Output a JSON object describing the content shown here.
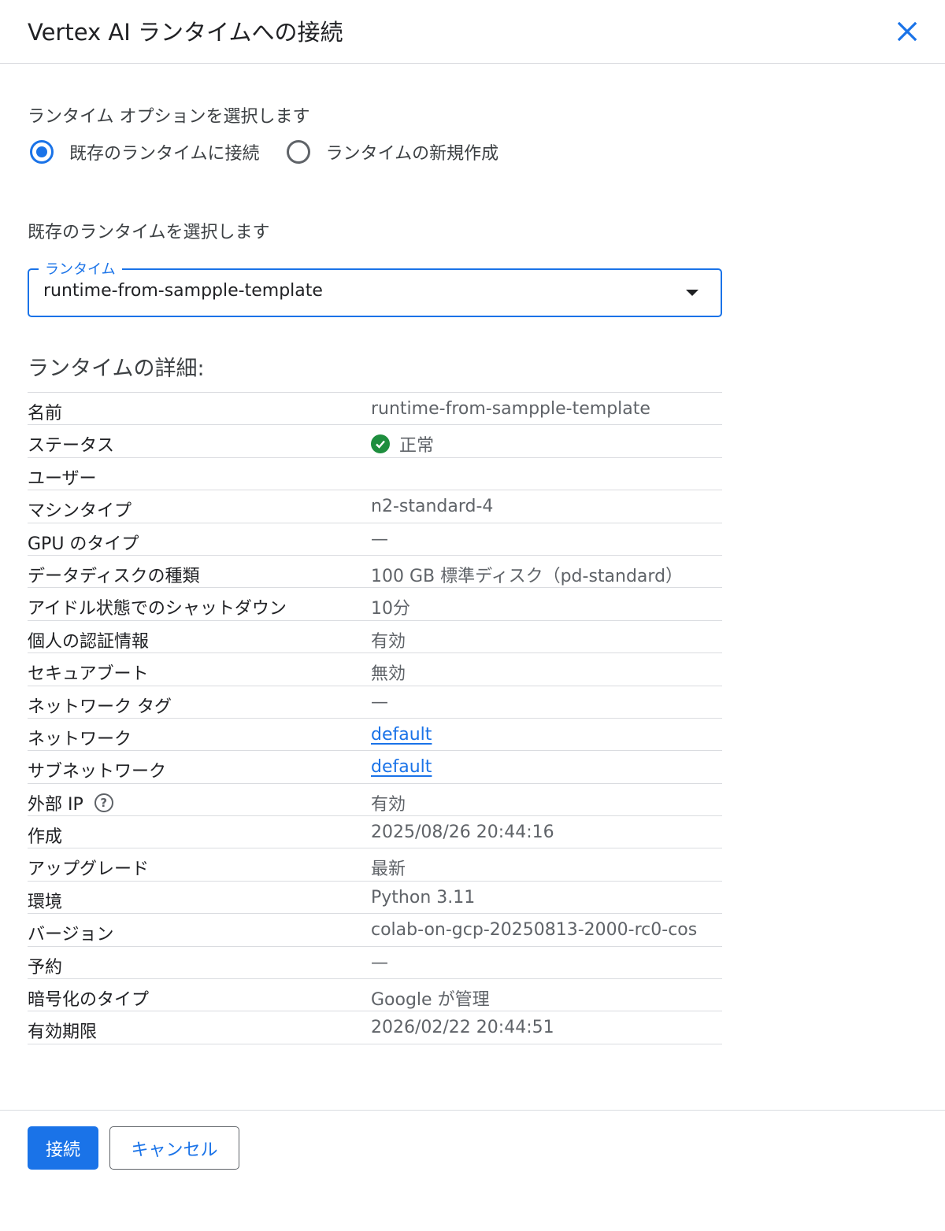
{
  "dialog": {
    "title": "Vertex AI ランタイムへの接続",
    "close_icon": "close-icon"
  },
  "runtime_option": {
    "label": "ランタイム オプションを選択します",
    "options": [
      {
        "label": "既存のランタイムに接続",
        "selected": true
      },
      {
        "label": "ランタイムの新規作成",
        "selected": false
      }
    ]
  },
  "existing_runtime": {
    "label": "既存のランタイムを選択します",
    "select_legend": "ランタイム",
    "select_value": "runtime-from-sampple-template"
  },
  "details": {
    "title": "ランタイムの詳細:",
    "rows": [
      {
        "key": "名前",
        "value": "runtime-from-sampple-template"
      },
      {
        "key": "ステータス",
        "value": "正常"
      },
      {
        "key": "ユーザー",
        "value": ""
      },
      {
        "key": "マシンタイプ",
        "value": "n2-standard-4"
      },
      {
        "key": "GPU のタイプ",
        "value": "—"
      },
      {
        "key": "データディスクの種類",
        "value": "100 GB 標準ディスク（pd-standard）"
      },
      {
        "key": "アイドル状態でのシャットダウン",
        "value": "10分"
      },
      {
        "key": "個人の認証情報",
        "value": "有効"
      },
      {
        "key": "セキュアブート",
        "value": "無効"
      },
      {
        "key": "ネットワーク タグ",
        "value": "—"
      },
      {
        "key": "ネットワーク",
        "value": "default"
      },
      {
        "key": "サブネットワーク",
        "value": "default"
      },
      {
        "key": "外部 IP",
        "value": "有効"
      },
      {
        "key": "作成",
        "value": "2025/08/26 20:44:16"
      },
      {
        "key": "アップグレード",
        "value": "最新"
      },
      {
        "key": "環境",
        "value": "Python 3.11"
      },
      {
        "key": "バージョン",
        "value": "colab-on-gcp-20250813-2000-rc0-cos"
      },
      {
        "key": "予約",
        "value": "—"
      },
      {
        "key": "暗号化のタイプ",
        "value": "Google が管理"
      },
      {
        "key": "有効期限",
        "value": "2026/02/22 20:44:51"
      }
    ]
  },
  "footer": {
    "connect_label": "接続",
    "cancel_label": "キャンセル"
  },
  "colors": {
    "accent": "#1a73e8",
    "status_ok": "#1e8e3e"
  }
}
